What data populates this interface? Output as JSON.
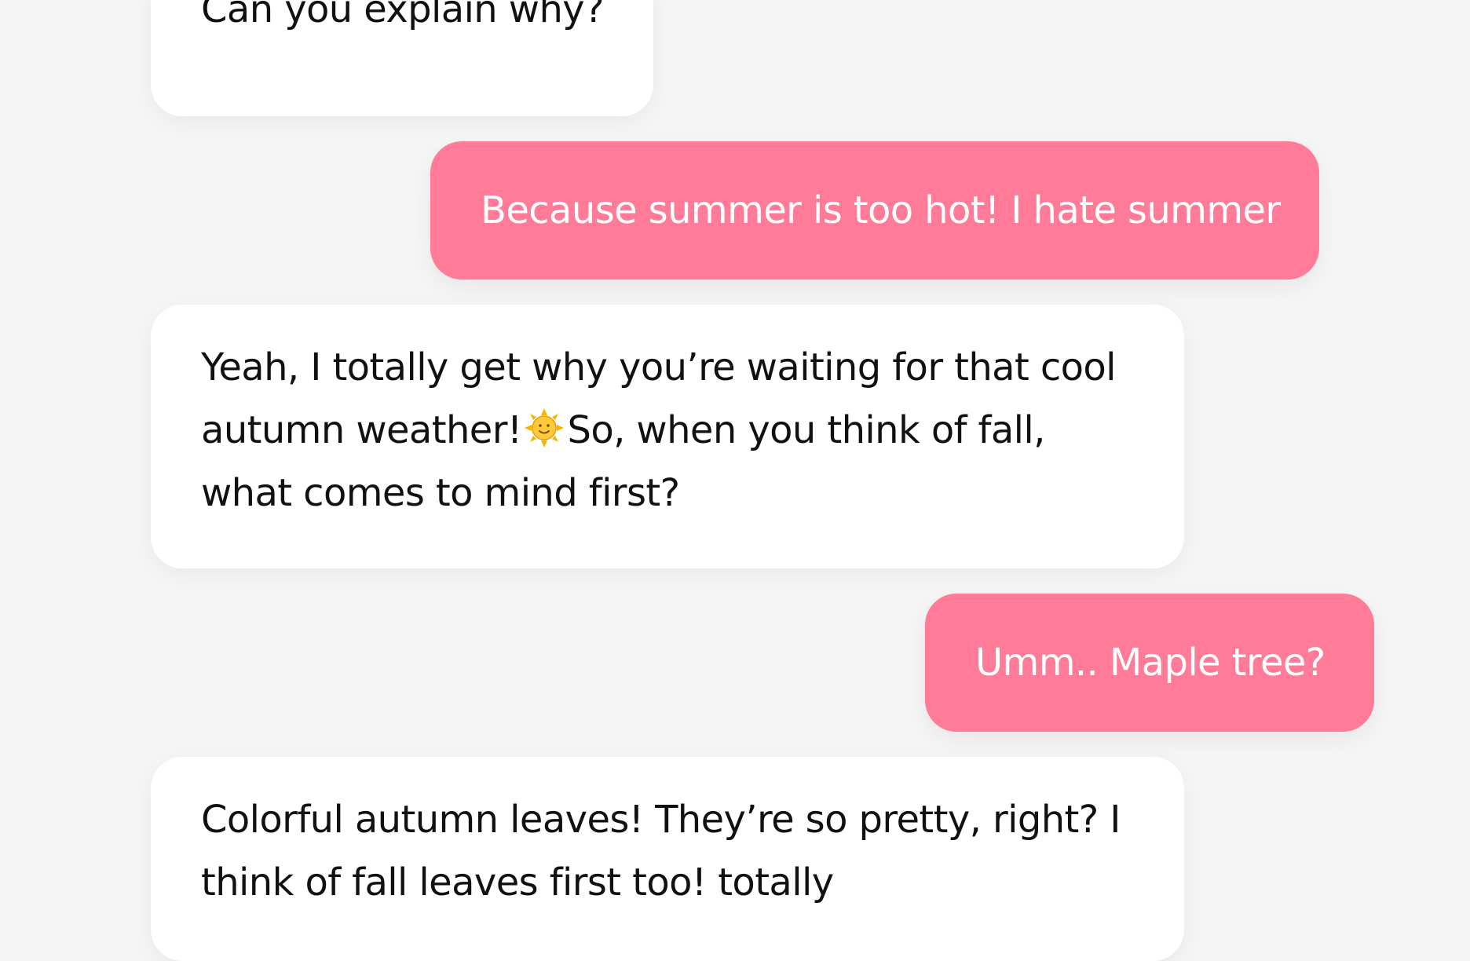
{
  "messages": [
    {
      "role": "bot",
      "text": "Can you explain why?"
    },
    {
      "role": "user",
      "text": "Because summer is too hot! I hate summer"
    },
    {
      "role": "bot",
      "lines": [
        "Yeah, I totally get why you’re waiting for that cool",
        "autumn weather!",
        "So, when you think of fall,",
        "what comes to mind first?"
      ],
      "icon": "sun-with-face-icon"
    },
    {
      "role": "user",
      "text": "Umm.. Maple tree?"
    },
    {
      "role": "bot",
      "lines": [
        "Colorful autumn leaves! They’re so pretty, right? I",
        "think of fall leaves first too! totally"
      ]
    }
  ],
  "colors": {
    "background": "#f5f5f5",
    "bot_bubble": "#ffffff",
    "user_bubble": "#ff7b98",
    "bot_text": "#111111",
    "user_text": "#ffffff"
  }
}
